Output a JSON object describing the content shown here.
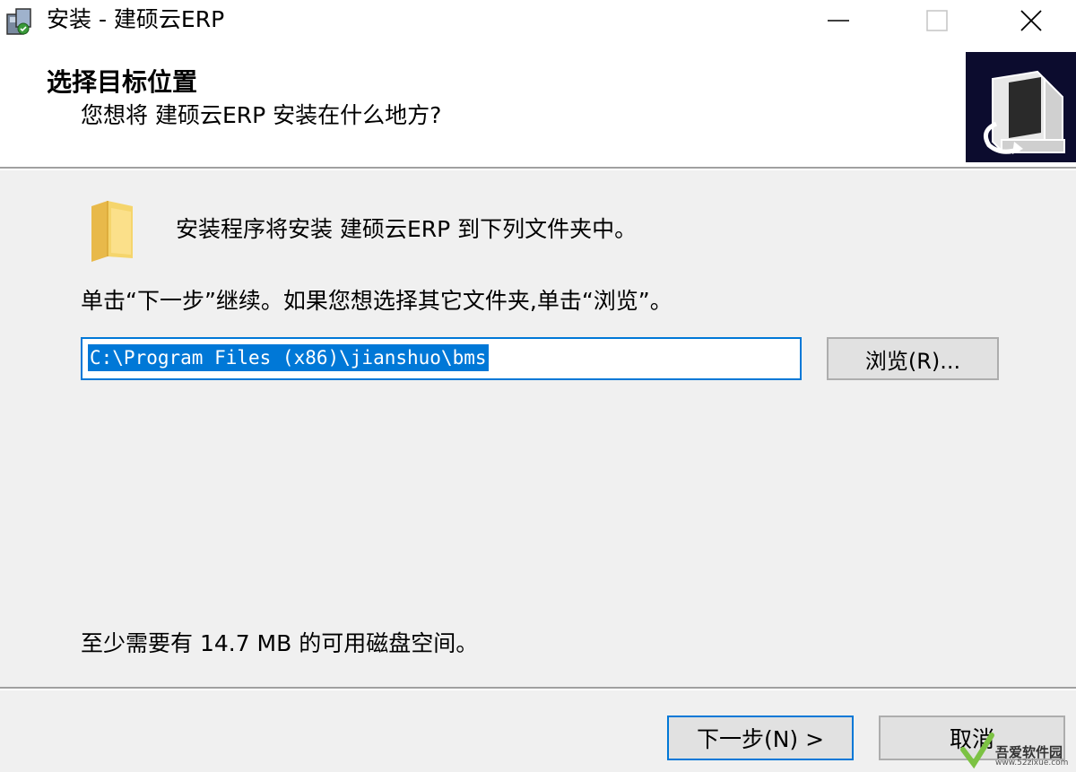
{
  "window": {
    "title": "安装 - 建硕云ERP",
    "icons": {
      "app": "installer-icon",
      "minimize": "minimize-icon",
      "maximize": "maximize-icon",
      "close": "close-icon"
    }
  },
  "header": {
    "title": "选择目标位置",
    "subtitle": "您想将 建硕云ERP 安装在什么地方?",
    "image_icon": "computer-install-icon"
  },
  "body": {
    "folder_icon": "folder-icon",
    "install_info": "安装程序将安装 建硕云ERP 到下列文件夹中。",
    "instruction": "单击“下一步”继续。如果您想选择其它文件夹,单击“浏览”。",
    "path_value": "C:\\Program Files (x86)\\jianshuo\\bms",
    "browse_label": "浏览(R)...",
    "disk_space": "至少需要有 14.7 MB 的可用磁盘空间。"
  },
  "footer": {
    "next_label": "下一步(N) >",
    "cancel_label": "取消"
  },
  "watermark": {
    "text": "吾爱软件园",
    "url": "www.52zixue.com"
  },
  "colors": {
    "accent": "#0078d7",
    "dialog_bg": "#f0f0f0",
    "button_bg": "#e1e1e1"
  }
}
